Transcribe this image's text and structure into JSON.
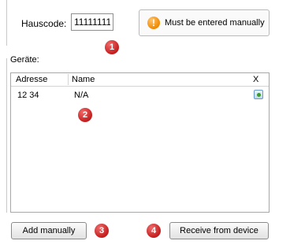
{
  "hauscode": {
    "label": "Hauscode:",
    "value": "11111111"
  },
  "warning": {
    "icon": "exclamation-icon",
    "text": "Must be entered manually",
    "color": "#f08a00"
  },
  "geraete": {
    "label": "Geräte:",
    "columns": [
      "Adresse",
      "Name",
      "X"
    ],
    "rows": [
      {
        "adresse": "12 34",
        "name": "N/A",
        "action_icon": "delete-icon"
      }
    ]
  },
  "buttons": {
    "add_manually": "Add manually",
    "receive_from_device": "Receive from device"
  },
  "badges": [
    "1",
    "2",
    "3",
    "4"
  ],
  "colors": {
    "badge": "#c41e1e",
    "border": "#a8a8a8"
  }
}
